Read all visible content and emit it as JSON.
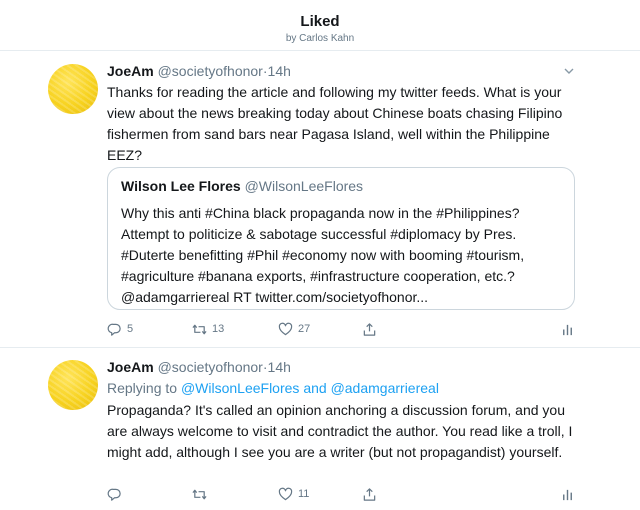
{
  "header": {
    "title": "Liked",
    "subtitle": "by Carlos Kahn"
  },
  "tweets": [
    {
      "name": "JoeAm",
      "handle": "@societyofhonor",
      "separator": "·",
      "time": "14h",
      "text": "Thanks for reading the article and following my twitter feeds. What is your view about the news breaking today about Chinese boats chasing Filipino fishermen from sand bars near Pagasa Island, well within the Philippine EEZ?",
      "quote": {
        "name": "Wilson Lee Flores",
        "handle": "@WilsonLeeFlores",
        "text": "Why this anti #China black propaganda now in the #Philippines? Attempt to politicize & sabotage successful #diplomacy by Pres. #Duterte benefitting #Phil #economy now with booming #tourism, #agriculture #banana exports, #infrastructure cooperation, etc.? @adamgarriereal RT twitter.com/societyofhonor..."
      },
      "actions": {
        "reply_count": "5",
        "retweet_count": "13",
        "like_count": "27"
      }
    },
    {
      "name": "JoeAm",
      "handle": "@societyofhonor",
      "separator": "·",
      "time": "14h",
      "replying_prefix": "Replying to",
      "replying_user1": "@WilsonLeeFlores",
      "replying_and": "and",
      "replying_user2": "@adamgarriereal",
      "text": "Propaganda? It's called an opinion anchoring a discussion forum, and you are always welcome to visit and contradict the author. You read like a troll, I might add, although I see you are a writer (but not propagandist) yourself.",
      "actions": {
        "reply_count": "",
        "retweet_count": "",
        "like_count": "11"
      }
    }
  ],
  "colors": {
    "accent": "#1da1f2",
    "muted": "#657786",
    "text": "#14171a",
    "divider": "#e6ecf0",
    "avatar": "#f7d21e"
  }
}
